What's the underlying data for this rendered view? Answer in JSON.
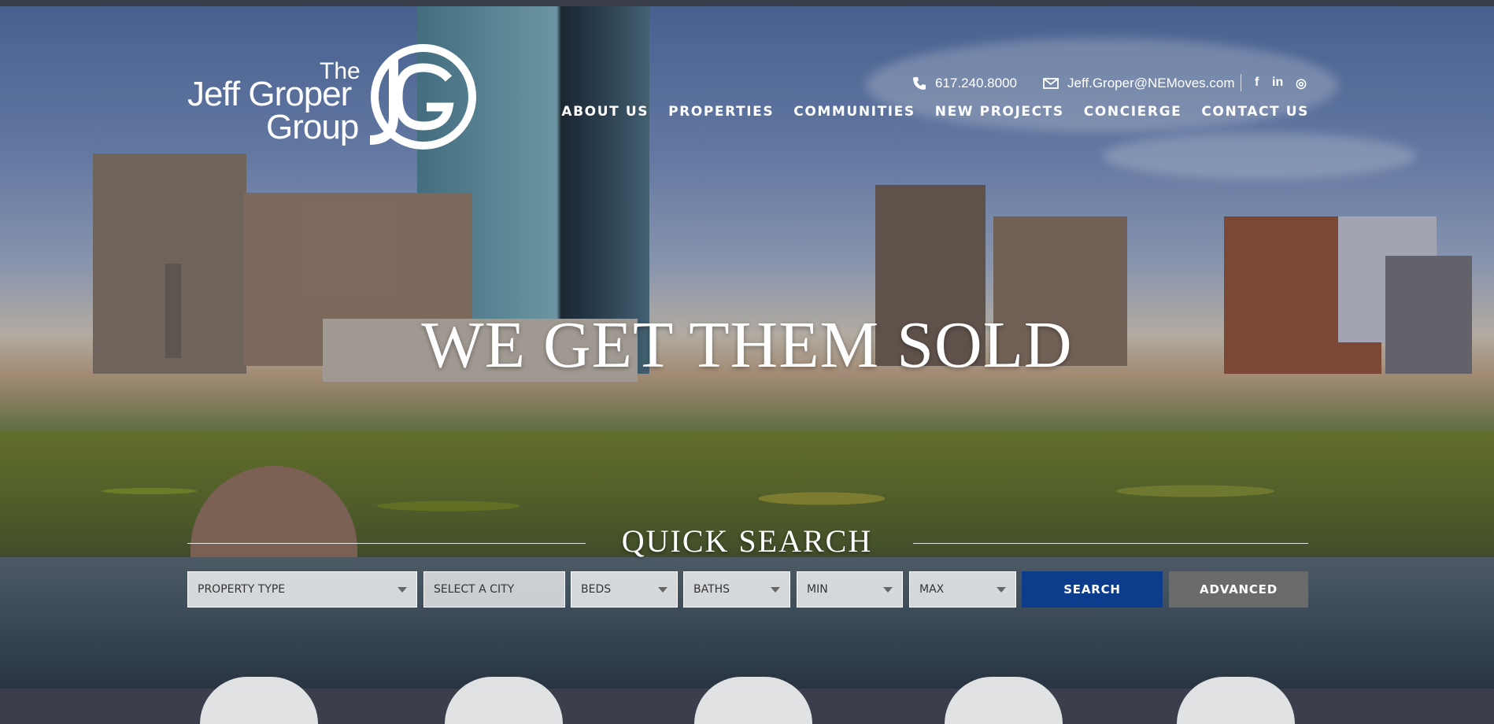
{
  "header": {
    "logo": {
      "the": "The",
      "line1": "Jeff Groper",
      "line2": "Group",
      "monogram": "JG"
    },
    "phone": "617.240.8000",
    "email": "Jeff.Groper@NEMoves.com",
    "social": [
      {
        "name": "facebook-icon",
        "glyph": "f"
      },
      {
        "name": "linkedin-icon",
        "glyph": "in"
      },
      {
        "name": "instagram-icon",
        "glyph": "◎"
      }
    ]
  },
  "nav": {
    "items": [
      {
        "label": "ABOUT US"
      },
      {
        "label": "PROPERTIES"
      },
      {
        "label": "COMMUNITIES"
      },
      {
        "label": "NEW PROJECTS"
      },
      {
        "label": "CONCIERGE"
      },
      {
        "label": "CONTACT US"
      }
    ]
  },
  "hero": {
    "headline": "WE GET THEM SOLD"
  },
  "quick_search": {
    "title": "QUICK SEARCH",
    "property_type": "PROPERTY TYPE",
    "city_placeholder": "SELECT A CITY",
    "beds": "BEDS",
    "baths": "BATHS",
    "min": "MIN",
    "max": "MAX",
    "search_label": "SEARCH",
    "advanced_label": "ADVANCED"
  },
  "colors": {
    "search_button": "#0b3d8c",
    "advanced_button": "#6b6b6b"
  }
}
